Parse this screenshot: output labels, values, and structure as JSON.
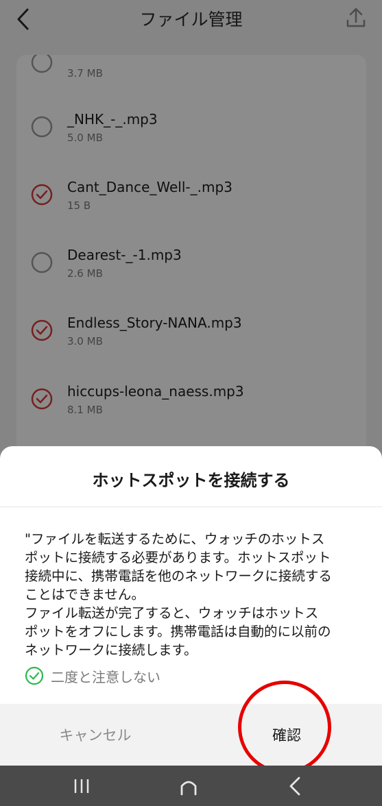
{
  "appbar": {
    "title": "ファイル管理"
  },
  "files": [
    {
      "name": "",
      "size": "3.7 MB",
      "checked": false
    },
    {
      "name": "_NHK_-_.mp3",
      "size": "5.0 MB",
      "checked": false
    },
    {
      "name": "Cant_Dance_Well-_.mp3",
      "size": "15 B",
      "checked": true
    },
    {
      "name": "Dearest-_-1.mp3",
      "size": "2.6 MB",
      "checked": false
    },
    {
      "name": "Endless_Story-NANA.mp3",
      "size": "3.0 MB",
      "checked": true
    },
    {
      "name": "hiccups-leona_naess.mp3",
      "size": "8.1 MB",
      "checked": true
    }
  ],
  "dialog": {
    "title": "ホットスポットを接続する",
    "message_lines": [
      "\"ファイルを転送するために、ウォッチのホットス",
      "ポットに接続する必要があります。ホットスポット",
      "接続中に、携帯電話を他のネットワークに接続する",
      "ことはできません。",
      "ファイル転送が完了すると、ウォッチはホットス",
      "ポットをオフにします。携帯電話は自動的に以前の",
      "ネットワークに接続します。"
    ],
    "dont_ask_label": "二度と注意しない",
    "dont_ask_checked": true,
    "cancel_label": "キャンセル",
    "confirm_label": "確認"
  },
  "colors": {
    "check_red": "#d83a3a",
    "check_green": "#2db84d",
    "highlight_red": "#e60000"
  },
  "icons": {
    "back": "chevron-left-icon",
    "upload": "upload-icon",
    "nav_recents": "recents-icon",
    "nav_home": "home-icon",
    "nav_back": "back-icon"
  }
}
